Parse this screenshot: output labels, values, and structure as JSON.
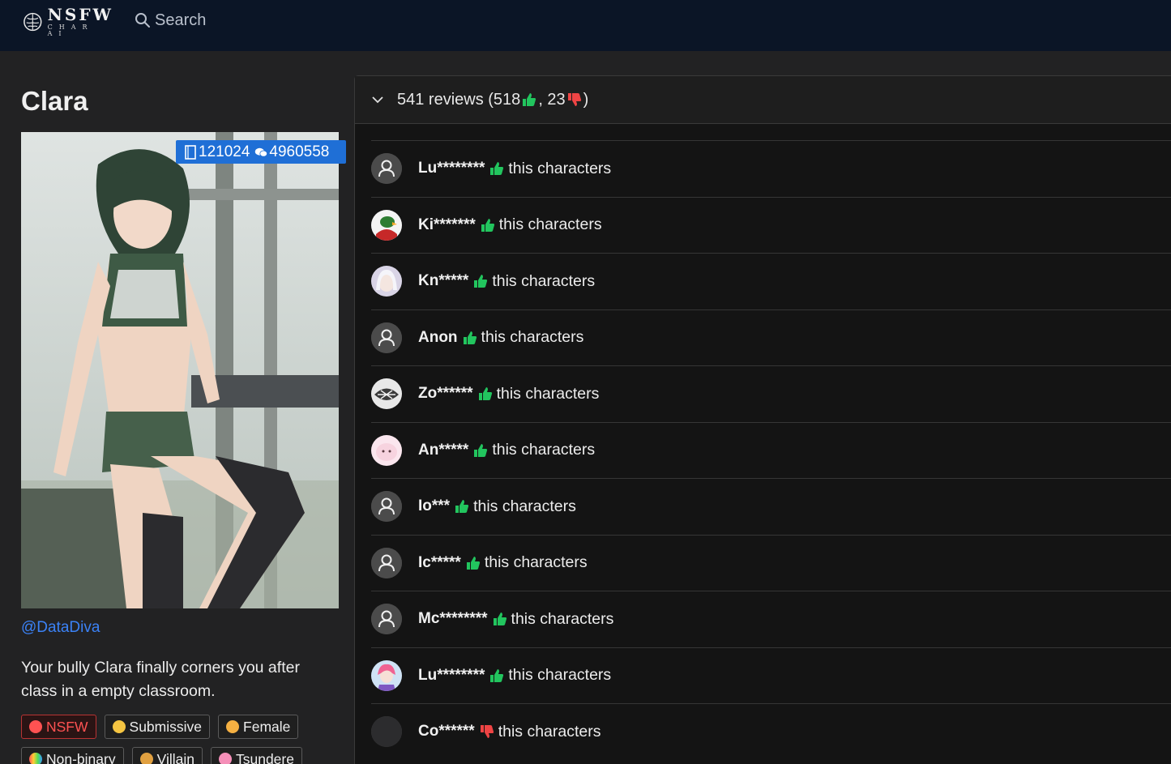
{
  "header": {
    "logo_main": "NSFW",
    "logo_sub": "CHAR AI",
    "search_label": "Search"
  },
  "character": {
    "name": "Clara",
    "stats": {
      "tokens": "121024",
      "chats": "4960558"
    },
    "creator": "@DataDiva",
    "description": "Your bully Clara finally corners you after class in a empty classroom.",
    "tags": [
      {
        "label": "NSFW",
        "icon": "18-plus-icon",
        "color": "#ff5252"
      },
      {
        "label": "Submissive",
        "icon": "submissive-emoji-icon",
        "color": "#f5c542"
      },
      {
        "label": "Female",
        "icon": "female-emoji-icon",
        "color": "#f5b042"
      },
      {
        "label": "Non-binary",
        "icon": "rainbow-icon",
        "color": "#7fd1f5"
      },
      {
        "label": "Villain",
        "icon": "villain-emoji-icon",
        "color": "#e0a040"
      },
      {
        "label": "Tsundere",
        "icon": "blossom-icon",
        "color": "#f58fb8"
      }
    ]
  },
  "reviews": {
    "summary_prefix": "541 reviews (518",
    "summary_mid": ", 23",
    "summary_suffix": ")",
    "colors": {
      "up": "#22c55e",
      "down": "#ef4444"
    },
    "items": [
      {
        "name": "Lu********",
        "vote": "up",
        "text": "this characters",
        "avatar": "default"
      },
      {
        "name": "Ki*******",
        "vote": "up",
        "text": "this characters",
        "avatar": "parrot"
      },
      {
        "name": "Kn*****",
        "vote": "up",
        "text": "this characters",
        "avatar": "anime-white"
      },
      {
        "name": "Anon",
        "vote": "up",
        "text": "this characters",
        "avatar": "default"
      },
      {
        "name": "Zo******",
        "vote": "up",
        "text": "this characters",
        "avatar": "sketch"
      },
      {
        "name": "An*****",
        "vote": "up",
        "text": "this characters",
        "avatar": "pink"
      },
      {
        "name": "Io***",
        "vote": "up",
        "text": "this characters",
        "avatar": "default"
      },
      {
        "name": "Ic*****",
        "vote": "up",
        "text": "this characters",
        "avatar": "default"
      },
      {
        "name": "Mc********",
        "vote": "up",
        "text": "this characters",
        "avatar": "default"
      },
      {
        "name": "Lu********",
        "vote": "up",
        "text": "this characters",
        "avatar": "anime-pink"
      },
      {
        "name": "Co******",
        "vote": "down",
        "text": "this characters",
        "avatar": "dark"
      }
    ]
  }
}
